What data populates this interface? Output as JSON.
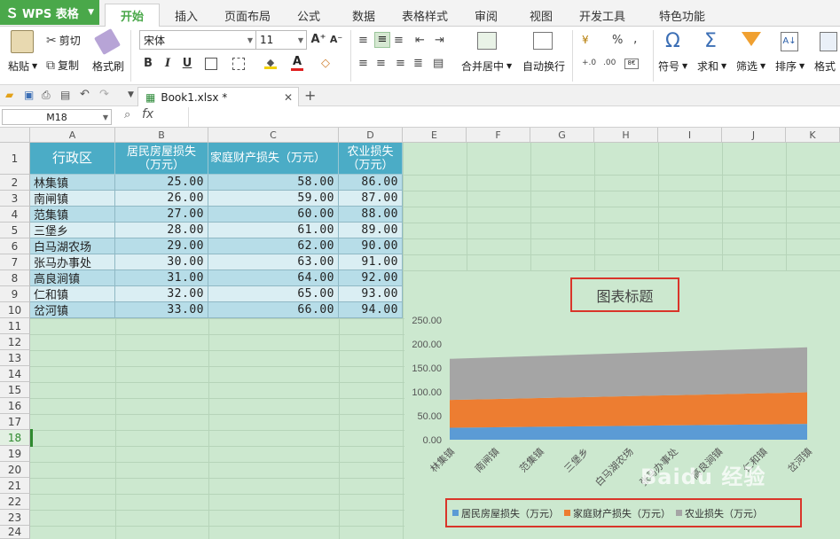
{
  "app": {
    "name": "WPS 表格"
  },
  "menu_tabs": [
    "开始",
    "插入",
    "页面布局",
    "公式",
    "数据",
    "表格样式",
    "审阅",
    "视图",
    "开发工具",
    "特色功能"
  ],
  "active_tab": "开始",
  "ribbon": {
    "paste_label": "粘贴",
    "cut_label": "剪切",
    "copy_label": "复制",
    "format_painter_label": "格式刷",
    "font_name": "宋体",
    "font_size": "11",
    "merge_center_label": "合并居中",
    "wrap_text_label": "自动换行",
    "symbol_label": "符号",
    "sum_label": "求和",
    "filter_label": "筛选",
    "sort_label": "排序",
    "format_label": "格式",
    "bold": "B",
    "italic": "I",
    "underline": "U",
    "percent": "%",
    "comma": ","
  },
  "file_tab": {
    "name": "Book1.xlsx *"
  },
  "name_box": "M18",
  "fx_label": "fx",
  "columns": [
    "A",
    "B",
    "C",
    "D",
    "E",
    "F",
    "G",
    "H",
    "I",
    "J",
    "K"
  ],
  "rows": [
    "1",
    "2",
    "3",
    "4",
    "5",
    "6",
    "7",
    "8",
    "9",
    "10",
    "11",
    "12",
    "13",
    "14",
    "15",
    "16",
    "17",
    "18",
    "19",
    "20",
    "21",
    "22",
    "23",
    "24"
  ],
  "selected_row": "18",
  "table": {
    "headers": [
      "行政区",
      "居民房屋损失（万元）",
      "家庭财产损失（万元）",
      "农业损失（万元）"
    ],
    "rows": [
      [
        "林集镇",
        "25.00",
        "58.00",
        "86.00"
      ],
      [
        "南闸镇",
        "26.00",
        "59.00",
        "87.00"
      ],
      [
        "范集镇",
        "27.00",
        "60.00",
        "88.00"
      ],
      [
        "三堡乡",
        "28.00",
        "61.00",
        "89.00"
      ],
      [
        "白马湖农场",
        "29.00",
        "62.00",
        "90.00"
      ],
      [
        "张马办事处",
        "30.00",
        "63.00",
        "91.00"
      ],
      [
        "高良涧镇",
        "31.00",
        "64.00",
        "92.00"
      ],
      [
        "仁和镇",
        "32.00",
        "65.00",
        "93.00"
      ],
      [
        "岔河镇",
        "33.00",
        "66.00",
        "94.00"
      ]
    ]
  },
  "watermark": "Baidu 经验",
  "colors": {
    "accent": "#4aa84a",
    "series1": "#5b9bd5",
    "series2": "#ed7d31",
    "series3": "#a5a5a5",
    "highlight": "#d9352a"
  },
  "chart_data": {
    "type": "area",
    "stacked": true,
    "title": "图表标题",
    "categories": [
      "林集镇",
      "南闸镇",
      "范集镇",
      "三堡乡",
      "白马湖农场",
      "张马办事处",
      "高良涧镇",
      "仁和镇",
      "岔河镇"
    ],
    "series": [
      {
        "name": "居民房屋损失（万元）",
        "values": [
          25,
          26,
          27,
          28,
          29,
          30,
          31,
          32,
          33
        ],
        "color": "#5b9bd5"
      },
      {
        "name": "家庭财产损失（万元）",
        "values": [
          58,
          59,
          60,
          61,
          62,
          63,
          64,
          65,
          66
        ],
        "color": "#ed7d31"
      },
      {
        "name": "农业损失（万元）",
        "values": [
          86,
          87,
          88,
          89,
          90,
          91,
          92,
          93,
          94
        ],
        "color": "#a5a5a5"
      }
    ],
    "yticks": [
      "250.00",
      "200.00",
      "150.00",
      "100.00",
      "50.00",
      "0.00"
    ],
    "ylim": [
      0,
      250
    ],
    "legend": "bottom",
    "grid": false
  }
}
